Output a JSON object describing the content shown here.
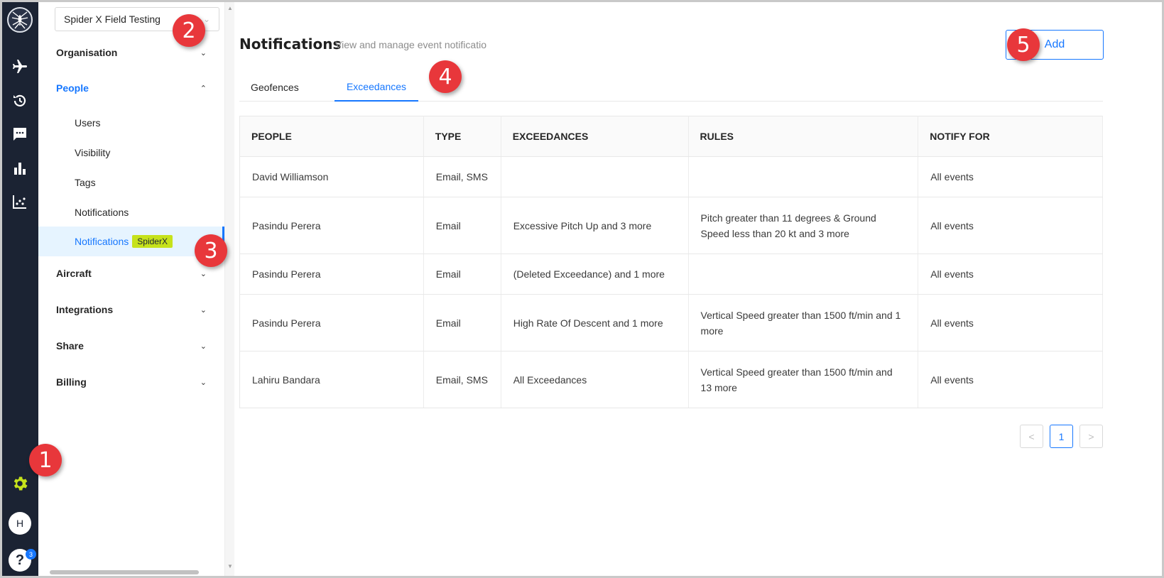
{
  "rail": {
    "icons": [
      "spider-logo",
      "plane-icon",
      "history-icon",
      "chat-icon",
      "bar-chart-icon",
      "scatter-chart-icon",
      "gear-icon"
    ],
    "avatar_initial": "H",
    "help_label": "?",
    "help_badge": "3",
    "accent_settings": "#c6e21b"
  },
  "sidebar": {
    "org_name": "Spider X Field Testing",
    "sections": [
      {
        "label": "Organisation"
      },
      {
        "label": "People"
      },
      {
        "label": "Aircraft"
      },
      {
        "label": "Integrations"
      },
      {
        "label": "Share"
      },
      {
        "label": "Billing"
      }
    ],
    "people_items": [
      {
        "label": "Users"
      },
      {
        "label": "Visibility"
      },
      {
        "label": "Tags"
      },
      {
        "label": "Notifications"
      },
      {
        "label": "Notifications",
        "tag": "SpiderX"
      }
    ]
  },
  "main": {
    "title": "Notifications",
    "subtitle": "View and manage event notificatio",
    "add_label": "Add",
    "tabs": [
      {
        "label": "Geofences"
      },
      {
        "label": "Exceedances"
      }
    ],
    "table": {
      "columns": [
        "PEOPLE",
        "TYPE",
        "EXCEEDANCES",
        "RULES",
        "NOTIFY FOR"
      ],
      "rows": [
        {
          "people": "David Williamson",
          "type": "Email, SMS",
          "exceedances": "",
          "rules": "",
          "notify": "All events"
        },
        {
          "people": "Pasindu Perera",
          "type": "Email",
          "exceedances": "Excessive Pitch Up and 3 more",
          "rules": "Pitch greater than 11 degrees & Ground Speed less than 20 kt and 3 more",
          "notify": "All events"
        },
        {
          "people": "Pasindu Perera",
          "type": "Email",
          "exceedances": "(Deleted Exceedance) and 1 more",
          "rules": "",
          "notify": "All events"
        },
        {
          "people": "Pasindu Perera",
          "type": "Email",
          "exceedances": "High Rate Of Descent and 1 more",
          "rules": "Vertical Speed greater than 1500 ft/min and 1 more",
          "notify": "All events"
        },
        {
          "people": "Lahiru Bandara",
          "type": "Email, SMS",
          "exceedances": "All Exceedances",
          "rules": "Vertical Speed greater than 1500 ft/min and 13 more",
          "notify": "All events"
        }
      ]
    },
    "pagination": {
      "prev": "<",
      "current": "1",
      "next": ">"
    }
  },
  "callouts": [
    "1",
    "2",
    "3",
    "4",
    "5"
  ],
  "colors": {
    "primary": "#1677ff",
    "rail_bg": "#1b2333",
    "callout": "#e8373b",
    "spiderx_tag": "#c6e21b"
  }
}
